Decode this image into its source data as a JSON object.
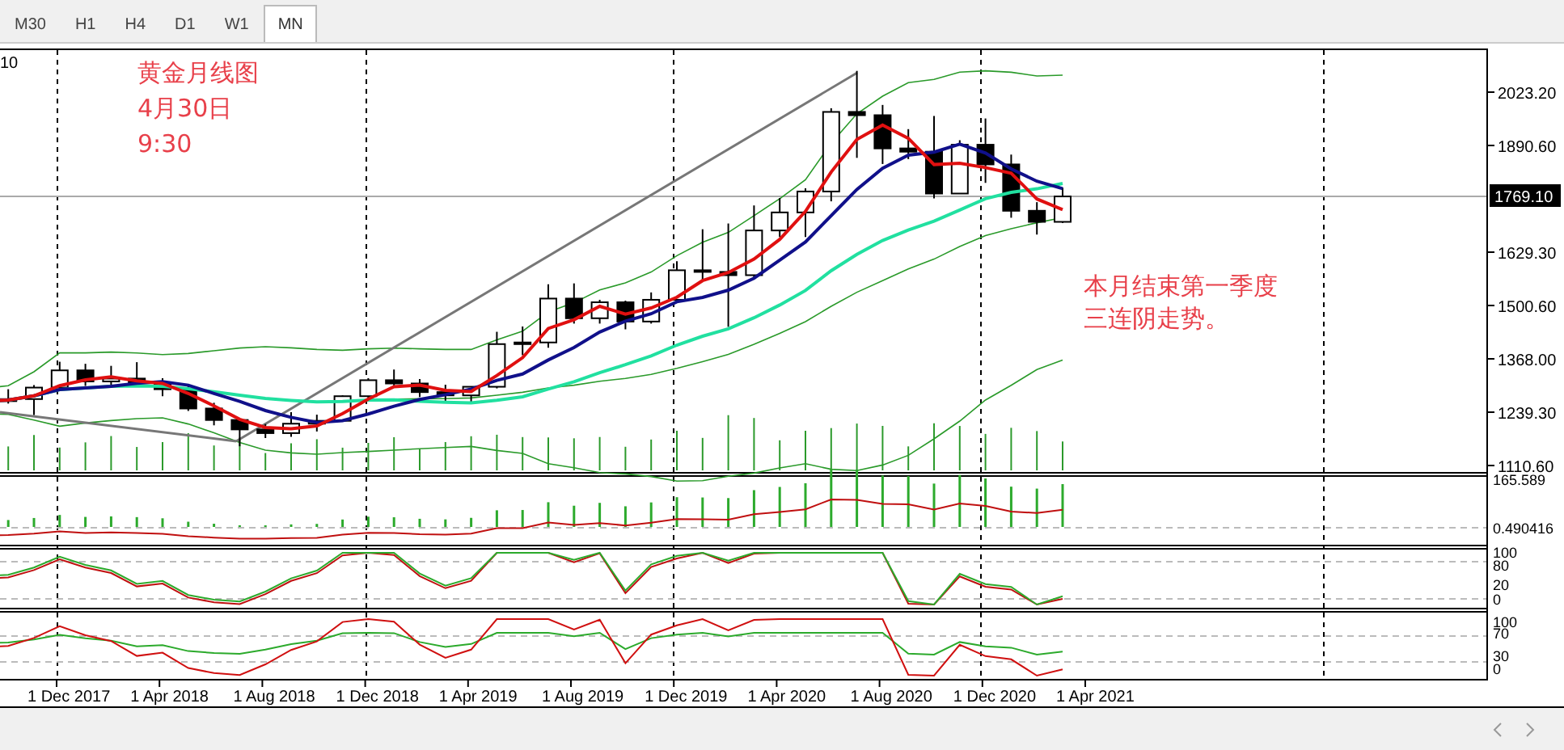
{
  "tabs": [
    {
      "label": "M30",
      "selected": false
    },
    {
      "label": "H1",
      "selected": false
    },
    {
      "label": "H4",
      "selected": false
    },
    {
      "label": "D1",
      "selected": false
    },
    {
      "label": "W1",
      "selected": false
    },
    {
      "label": "MN",
      "selected": true
    }
  ],
  "chart": {
    "header": "10",
    "price_labels": [
      "2023.20",
      "1890.60",
      "1629.30",
      "1500.60",
      "1368.00",
      "1239.30",
      "1110.60"
    ],
    "current_price": "1769.10",
    "notes": [
      {
        "lines": [
          "黄金月线图",
          "4月30日",
          "9:30"
        ]
      },
      {
        "lines": [
          "本月结束第一季度",
          "三连阴走势。"
        ]
      }
    ],
    "dates": [
      "1 Dec 2017",
      "1 Apr 2018",
      "1 Aug 2018",
      "1 Dec 2018",
      "1 Apr 2019",
      "1 Aug 2019",
      "1 Dec 2019",
      "1 Apr 2020",
      "1 Aug 2020",
      "1 Dec 2020",
      "1 Apr 2021"
    ]
  },
  "indicators": [
    {
      "labels": [
        "165.589",
        "0.490416"
      ]
    },
    {
      "labels": [
        "100",
        "80",
        "20",
        "0"
      ]
    },
    {
      "labels": [
        "100",
        "70",
        "30",
        "0"
      ]
    }
  ]
}
